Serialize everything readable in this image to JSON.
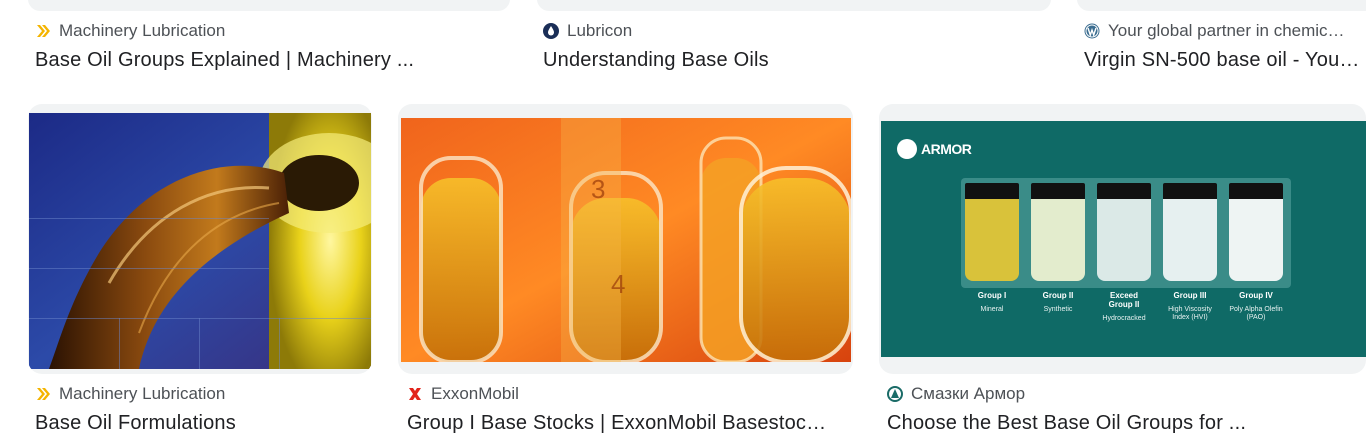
{
  "row1": [
    {
      "source": "Machinery Lubrication",
      "source_icon": "chevron-double-icon",
      "title": "Base Oil Groups Explained | Machinery ..."
    },
    {
      "source": "Lubricon",
      "source_icon": "drop-icon",
      "title": "Understanding Base Oils"
    },
    {
      "source": "Your global partner in chemic…",
      "source_icon": "wordpress-icon",
      "title": "Virgin SN-500 base oil - You…"
    }
  ],
  "row2": [
    {
      "source": "Machinery Lubrication",
      "source_icon": "chevron-double-icon",
      "title": "Base Oil Formulations"
    },
    {
      "source": "ExxonMobil",
      "source_icon": "exxon-x-icon",
      "title": "Group I Base Stocks | ExxonMobil Basestoc…"
    },
    {
      "source": "Смазки Армор",
      "source_icon": "armor-icon",
      "title": "Choose the Best Base Oil Groups for ..."
    }
  ],
  "armor_image": {
    "brand": "ARMOR",
    "groups": [
      {
        "label": "Group I",
        "desc": "Mineral",
        "color": "#d9c23a"
      },
      {
        "label": "Group II",
        "desc": "Synthetic",
        "color": "#e3eccd"
      },
      {
        "label": "Exceed Group II",
        "desc": "Hydrocracked",
        "color": "#dbe9e7"
      },
      {
        "label": "Group III",
        "desc": "High Viscosity Index (HVI)",
        "color": "#e6f0f0"
      },
      {
        "label": "Group IV",
        "desc": "Poly Alpha Olefin (PAO)",
        "color": "#eef4f3"
      }
    ]
  },
  "colors": {
    "accent_lubrication": "#f4b400",
    "accent_exxon": "#e2231a",
    "armor_bg": "#0f6a66"
  }
}
